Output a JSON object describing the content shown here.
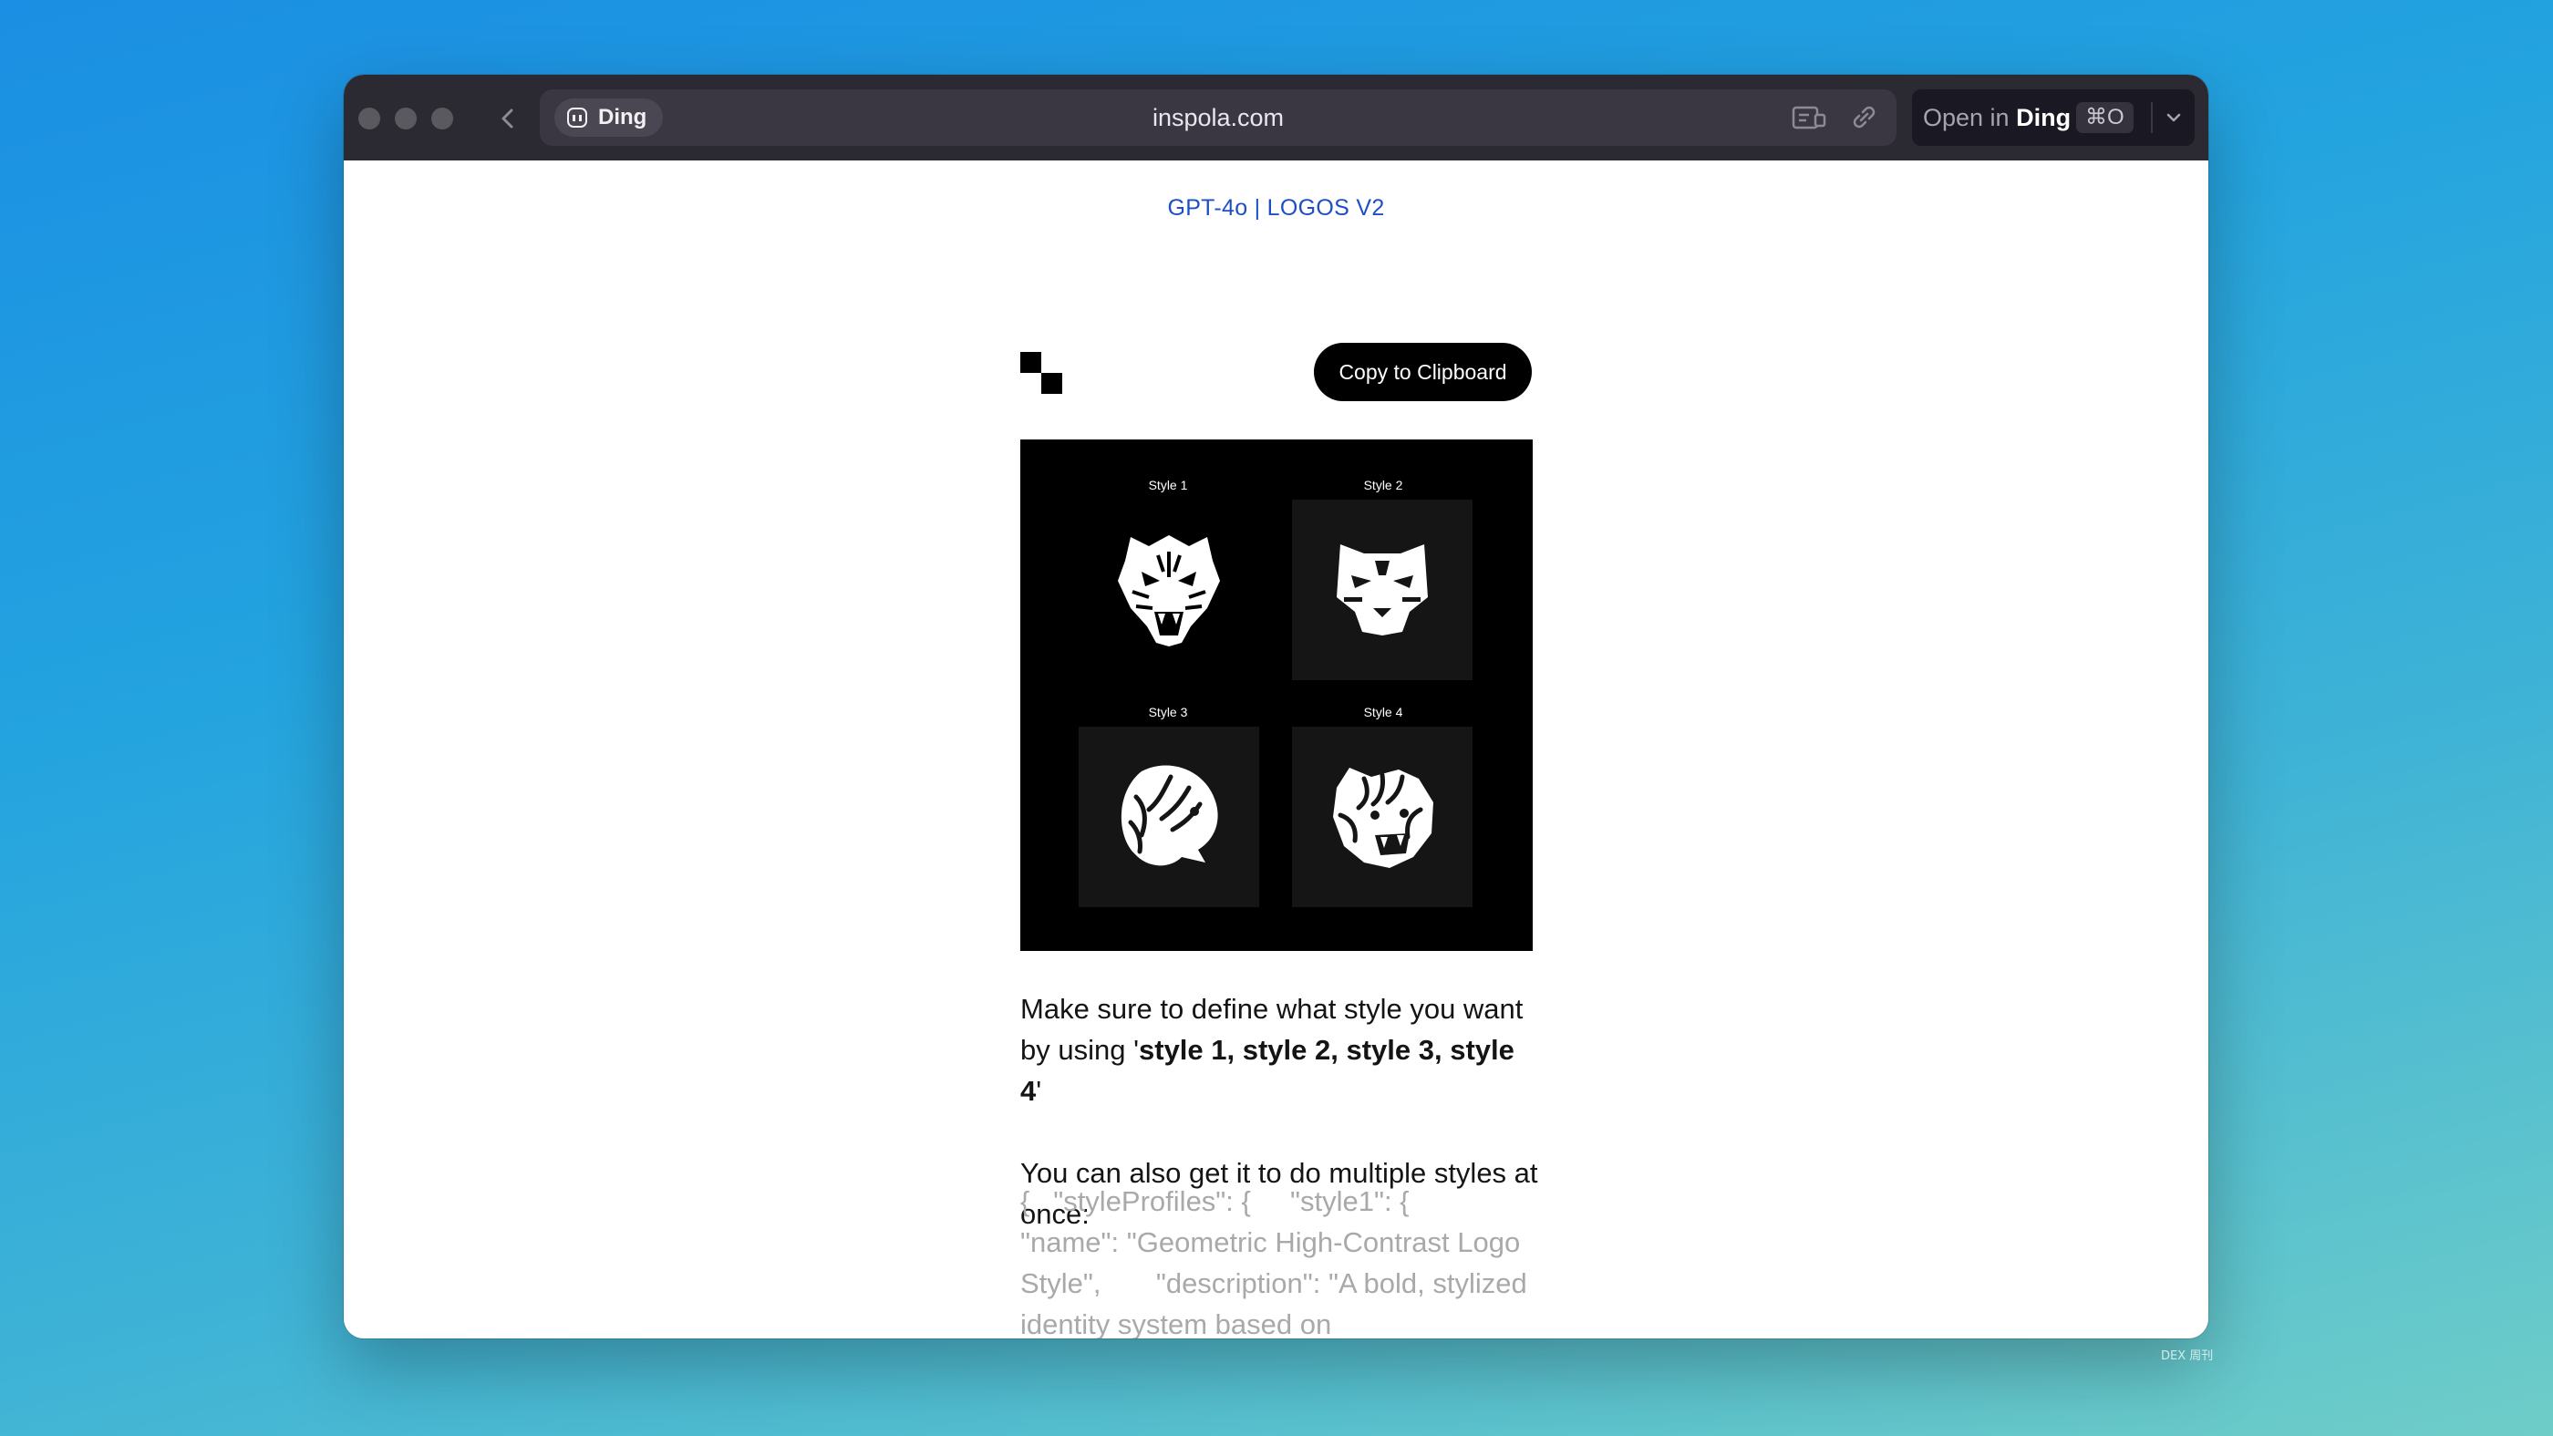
{
  "browser": {
    "app_badge": "Ding",
    "url": "inspola.com",
    "open_in_prefix": "Open in",
    "open_in_app": "Ding",
    "shortcut": "⌘O"
  },
  "page": {
    "heading": "GPT-4o | LOGOS V2",
    "copy_button": "Copy to Clipboard",
    "preview": {
      "style_labels": [
        "Style 1",
        "Style 2",
        "Style 3",
        "Style 4"
      ]
    },
    "para1_pre": "Make sure to define what style you want by using '",
    "para1_bold": "style 1, style 2, style 3, style 4",
    "para1_post": "'",
    "para2": "You can also get it to do multiple styles at once:",
    "code_snippet": "{   \"styleProfiles\": {     \"style1\": {       \"name\": \"Geometric High-Contrast Logo Style\",       \"description\": \"A bold, stylized identity system based on"
  },
  "watermark": "DEX 周刊",
  "icons": {
    "back": "chevron-left-icon",
    "reader": "reader-mode-icon",
    "link": "link-icon",
    "dropdown": "chevron-down-icon"
  }
}
